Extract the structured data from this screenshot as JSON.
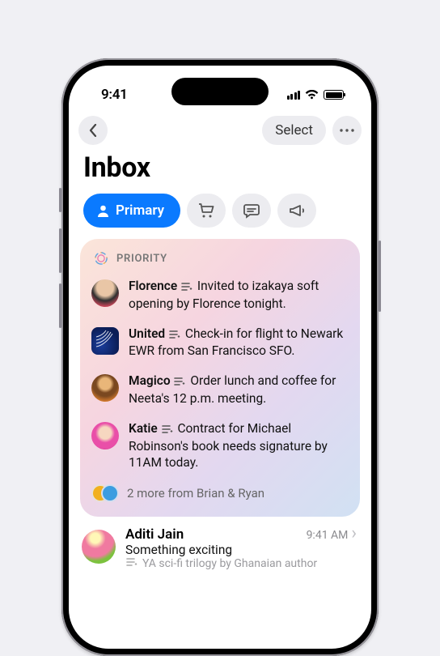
{
  "status": {
    "time": "9:41"
  },
  "nav": {
    "select": "Select"
  },
  "title": "Inbox",
  "tabs": {
    "primary": "Primary"
  },
  "priority": {
    "label": "PRIORITY",
    "items": [
      {
        "sender": "Florence",
        "summary": "Invited to izakaya soft opening by Florence tonight."
      },
      {
        "sender": "United",
        "summary": "Check-in for flight to Newark EWR from San Francisco SFO."
      },
      {
        "sender": "Magico",
        "summary": "Order lunch and coffee for Neeta's 12 p.m. meeting."
      },
      {
        "sender": "Katie",
        "summary": "Contract for Michael Robinson's book needs signature by 11AM today."
      }
    ],
    "more": "2 more from Brian & Ryan"
  },
  "list": [
    {
      "sender": "Aditi Jain",
      "time": "9:41 AM",
      "subject": "Something exciting",
      "preview": "YA sci-fi trilogy by Ghanaian author"
    }
  ]
}
